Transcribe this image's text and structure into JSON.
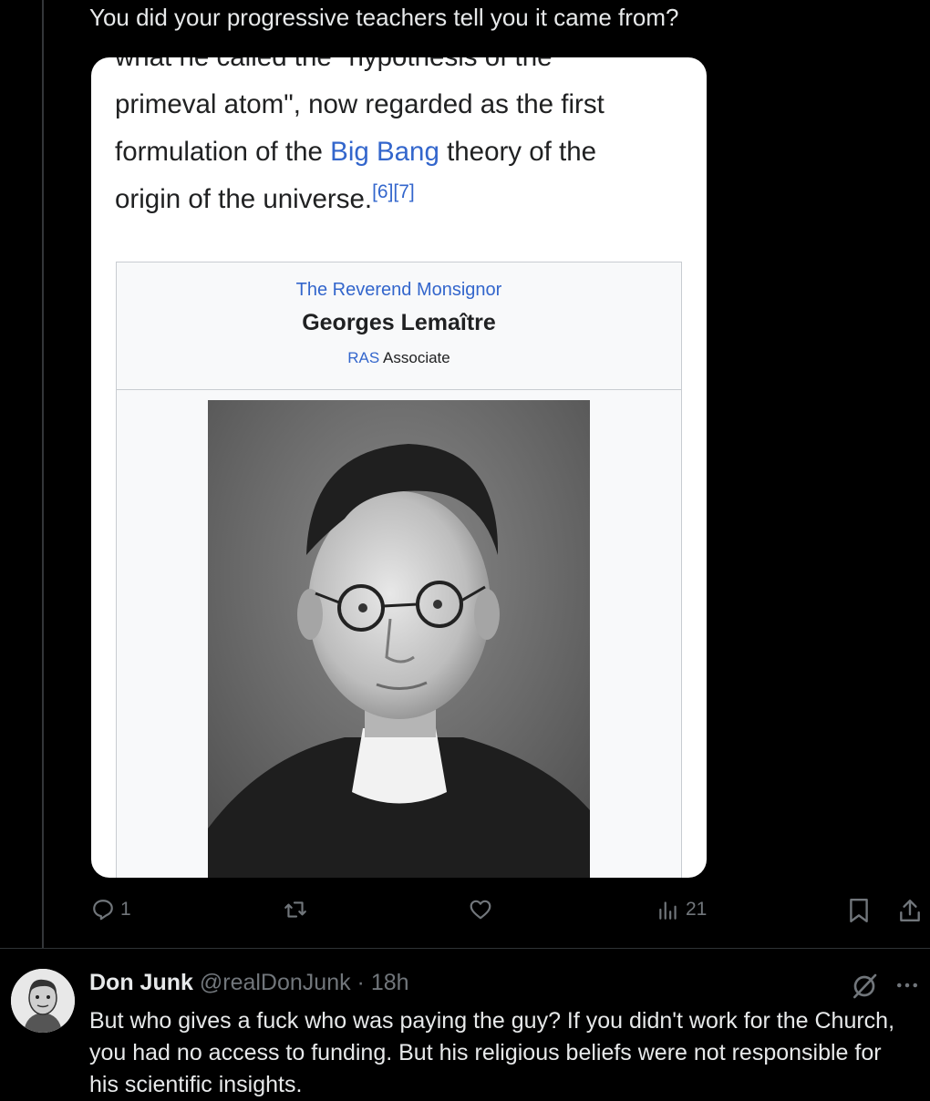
{
  "post": {
    "text": "You did your progressive teachers tell you it came from?"
  },
  "wiki": {
    "line0": "what he called the \"hypothesis of the",
    "line1": "primeval atom\", now regarded as the first",
    "line2_pre": "formulation of the ",
    "line2_link": "Big Bang",
    "line2_post": " theory of the",
    "line3": "origin of the universe.",
    "refs": "[6][7]"
  },
  "infobox": {
    "honorific": "The Reverend Monsignor",
    "name": "Georges Lemaître",
    "post_link": "RAS",
    "post_text": " Associate"
  },
  "actions": {
    "replies": "1",
    "reposts": "",
    "likes": "",
    "views": "21"
  },
  "reply": {
    "name": "Don Junk",
    "handle": "@realDonJunk",
    "sep": " · ",
    "time": "18h",
    "body": "But who gives a fuck who was paying the guy? If you didn't work for the Church, you had no access to funding. But his religious beliefs were not responsible for his scientific insights."
  },
  "colors": {
    "background": "#000000",
    "text": "#e7e9ea",
    "muted": "#71767b",
    "wiki_link": "#3366cc"
  },
  "icons": [
    "reply-icon",
    "repost-icon",
    "like-icon",
    "views-icon",
    "bookmark-icon",
    "share-icon",
    "grok-icon",
    "more-icon"
  ]
}
